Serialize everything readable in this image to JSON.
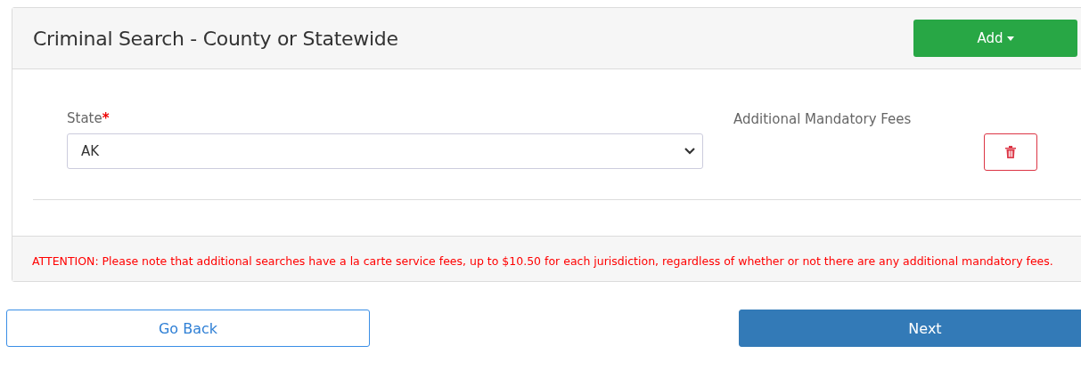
{
  "card": {
    "title": "Criminal Search - County or Statewide",
    "add_button": "Add"
  },
  "row": {
    "state_label": "State",
    "required_mark": "*",
    "state_value": "AK",
    "fees_label": "Additional Mandatory Fees"
  },
  "notice": "ATTENTION: Please note that additional searches have a la carte service fees, up to $10.50 for each jurisdiction, regardless of whether or not there are any additional mandatory fees.",
  "buttons": [
    {
      "label": "Go Back",
      "kind": "outline"
    },
    {
      "label": "Next",
      "kind": "primary"
    }
  ]
}
